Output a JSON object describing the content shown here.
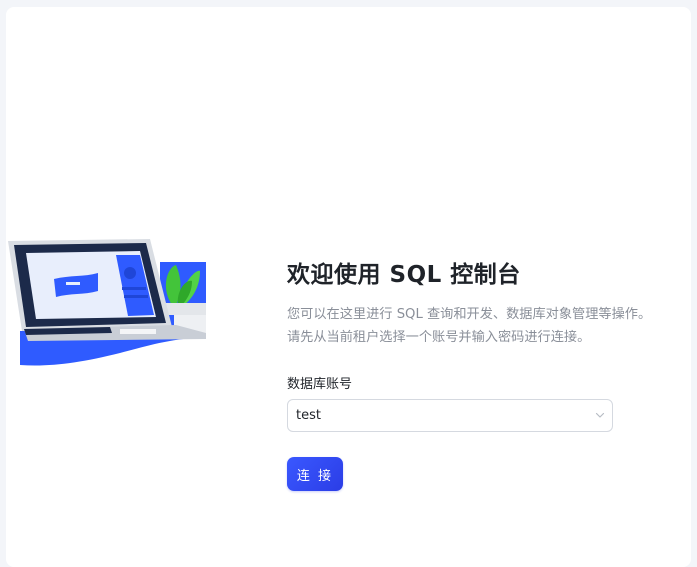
{
  "welcome": {
    "title": "欢迎使用 SQL 控制台",
    "description_lines": [
      "您可以在这里进行 SQL 查询和开发、数据库对象管理等操作。",
      "请先从当前租户选择一个账号并输入密码进行连接。"
    ]
  },
  "form": {
    "account_label": "数据库账号",
    "account_value": "test",
    "connect_label": "连 接"
  },
  "colors": {
    "accent": "#3450f5",
    "title": "#1f2329",
    "muted": "#8a8f99"
  },
  "icons": {
    "select_arrow": "chevron-down-icon",
    "illustration": "laptop-illustration"
  }
}
